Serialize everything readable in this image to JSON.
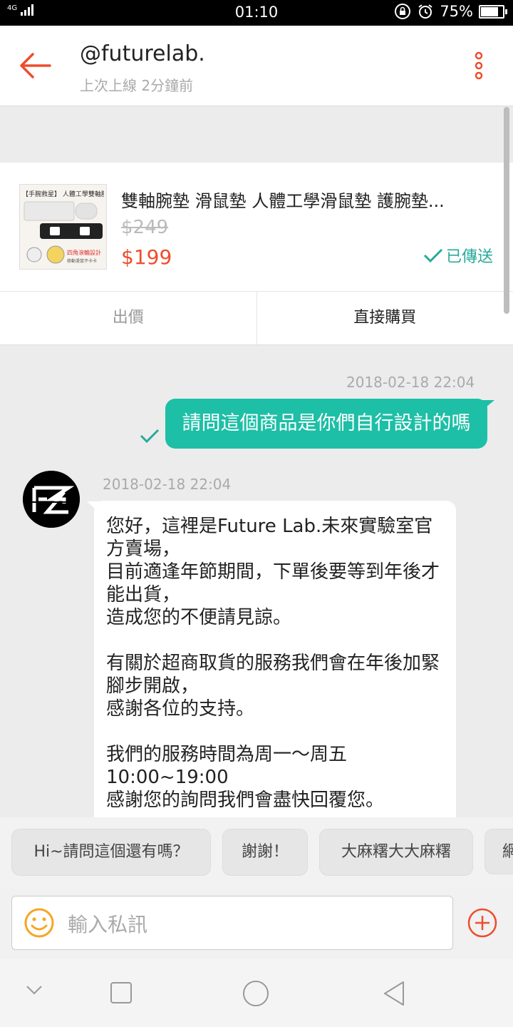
{
  "status_bar": {
    "signal": "4G",
    "time": "01:10",
    "battery": "75%",
    "battery_level": 0.75
  },
  "header": {
    "title": "@futurelab.",
    "subtitle": "上次上線 2分鐘前"
  },
  "product": {
    "name": "雙軸腕墊 滑鼠墊 人體工學滑鼠墊 護腕墊...",
    "original_price": "$249",
    "price": "$199",
    "sent_label": "已傳送",
    "thumb_text_1": "【手腕救星】 人體工學雙軸腕墊",
    "thumb_text_2": "四角滾輪設計",
    "thumb_text_3": "移動滑鼠不卡卡"
  },
  "actions": {
    "offer": "出價",
    "buy": "直接購買"
  },
  "messages": [
    {
      "sender": "me",
      "timestamp": "2018-02-18 22:04",
      "text": "請問這個商品是你們自行設計的嗎"
    },
    {
      "sender": "shop",
      "timestamp": "2018-02-18 22:04",
      "lines": [
        "您好，這裡是Future Lab.未來實驗室官方賣場，",
        "目前適逢年節期間，下單後要等到年後才能出貨，",
        "造成您的不便請見諒。",
        "",
        "有關於超商取貨的服務我們會在年後加緊腳步開啟，",
        "感謝各位的支持。",
        "",
        "我們的服務時間為周一～周五",
        "10:00~19:00",
        "感謝您的詢問我們會盡快回覆您。"
      ]
    }
  ],
  "quick_replies": [
    "Hi~請問這個還有嗎？",
    "謝謝！",
    "大麻糬大大麻糬",
    "網"
  ],
  "input": {
    "placeholder": "輸入私訊"
  },
  "colors": {
    "accent": "#ee4d2d",
    "teal": "#1dbfa6",
    "sent": "#26aa99"
  }
}
